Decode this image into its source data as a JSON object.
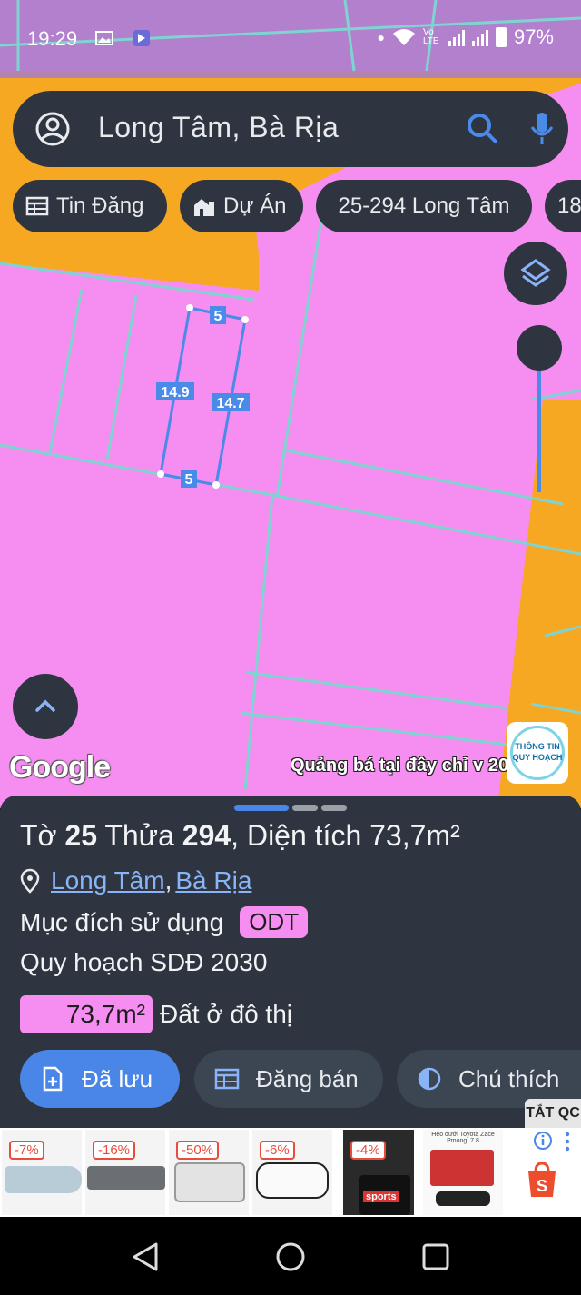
{
  "status_bar": {
    "time": "19:29",
    "battery": "97%",
    "network_label": "Vo LTE"
  },
  "search": {
    "query": "Long Tâm, Bà Rịa"
  },
  "chips": [
    {
      "label": "Tin Đăng",
      "icon": "calendar-grid-icon"
    },
    {
      "label": "Dự Án",
      "icon": "house-building-icon"
    },
    {
      "label": "25-294 Long Tâm",
      "icon": ""
    },
    {
      "label": "18",
      "icon": ""
    }
  ],
  "map": {
    "parcel_labels": {
      "top": "5",
      "left": "14.9",
      "right": "14.7",
      "bottom": "5"
    },
    "google_logo": "Google",
    "ad_overlay": "Quảng bá tại đây chỉ v",
    "ad_overlay_suffix": "2030",
    "logo_line1": "THÔNG TIN",
    "logo_line2": "QUY HOẠCH",
    "colors": {
      "land_residential": "#f58ef0",
      "road": "#f7a823",
      "parcel_border": "#7fd3d0",
      "selection": "#4a8ae8"
    }
  },
  "sheet": {
    "title_prefix": "Tờ ",
    "sheet_no": "25",
    "parcel_prefix": " Thửa ",
    "parcel_no": "294",
    "area_text": ", Diện tích 73,7m²",
    "location_1": "Long Tâm",
    "location_sep": ",",
    "location_2": "Bà Rịa",
    "usage_label": "Mục đích sử dụng",
    "usage_code": "ODT",
    "plan_label": "Quy hoạch SDĐ 2030",
    "area_value": "73,7m²",
    "area_desc": "Đất ở đô thị",
    "buttons": [
      {
        "label": "Đã lưu",
        "icon": "file-plus-icon"
      },
      {
        "label": "Đăng bán",
        "icon": "calendar-icon"
      },
      {
        "label": "Chú thích",
        "icon": "contrast-icon"
      }
    ]
  },
  "ads": {
    "close_label": "TẮT QC",
    "items": [
      {
        "discount": "-7%"
      },
      {
        "discount": "-16%"
      },
      {
        "discount": "-50%"
      },
      {
        "discount": "-6%"
      },
      {
        "discount": "-4%"
      },
      {
        "discount": ""
      }
    ],
    "item6_caption": "Heo dưới Toyota Zace Pmong: 7.8",
    "item5_caption": "sports"
  }
}
